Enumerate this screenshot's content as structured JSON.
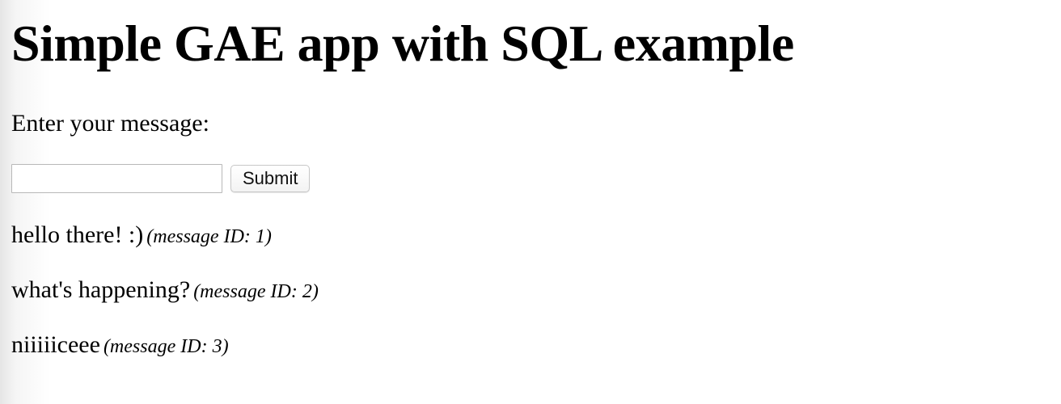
{
  "page": {
    "title": "Simple GAE app with SQL example",
    "prompt": "Enter your message:"
  },
  "form": {
    "message_value": "",
    "submit_label": "Submit"
  },
  "messages": [
    {
      "text": "hello there! :)",
      "meta": "(message ID: 1)"
    },
    {
      "text": "what's happening?",
      "meta": "(message ID: 2)"
    },
    {
      "text": "niiiiiceee",
      "meta": "(message ID: 3)"
    }
  ]
}
